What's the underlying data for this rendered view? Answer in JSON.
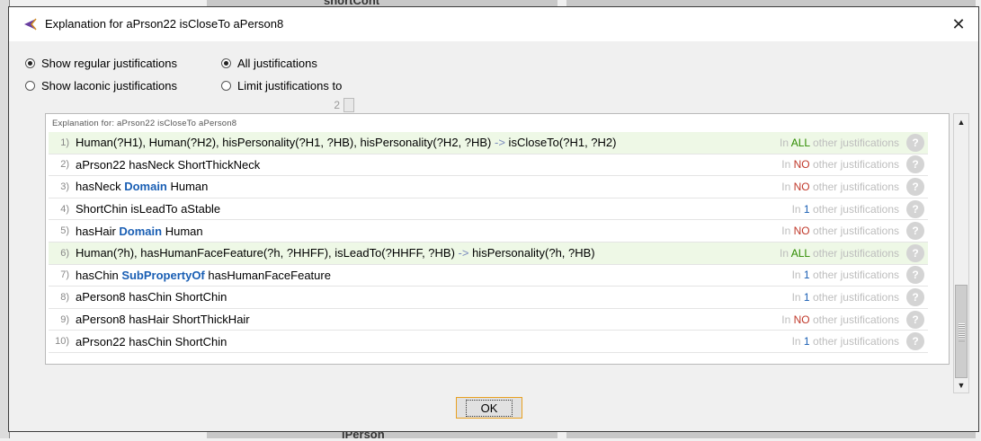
{
  "dialog": {
    "title": "Explanation for aPrson22 isCloseTo aPerson8",
    "close_label": "✕"
  },
  "options": {
    "show_regular": "Show regular justifications",
    "show_laconic": "Show laconic justifications",
    "all_justifications": "All justifications",
    "limit_justifications": "Limit justifications to",
    "limit_value": "2",
    "selected_mode": "regular",
    "selected_scope": "all"
  },
  "panel": {
    "header": "Explanation for: aPrson22 isCloseTo aPerson8",
    "rows": [
      {
        "num": "1)",
        "highlight": true,
        "parts": [
          {
            "t": "Human(?H1), Human(?H2), hisPersonality(?H1, ?HB), hisPersonality(?H2, ?HB) "
          },
          {
            "t": "->",
            "c": "arrow"
          },
          {
            "t": " isCloseTo(?H1, ?H2)"
          }
        ],
        "just_pre": "In ",
        "just_count": "ALL",
        "just_type": "all",
        "just_post": " other justifications"
      },
      {
        "num": "2)",
        "highlight": false,
        "parts": [
          {
            "t": "aPrson22 hasNeck ShortThickNeck"
          }
        ],
        "just_pre": "In ",
        "just_count": "NO",
        "just_type": "no",
        "just_post": " other justifications"
      },
      {
        "num": "3)",
        "highlight": false,
        "parts": [
          {
            "t": "hasNeck "
          },
          {
            "t": "Domain",
            "c": "kw"
          },
          {
            "t": " Human"
          }
        ],
        "just_pre": "In ",
        "just_count": "NO",
        "just_type": "no",
        "just_post": " other justifications"
      },
      {
        "num": "4)",
        "highlight": false,
        "parts": [
          {
            "t": "ShortChin isLeadTo aStable"
          }
        ],
        "just_pre": "In ",
        "just_count": "1",
        "just_type": "one",
        "just_post": " other justifications"
      },
      {
        "num": "5)",
        "highlight": false,
        "parts": [
          {
            "t": "hasHair "
          },
          {
            "t": "Domain",
            "c": "kw"
          },
          {
            "t": " Human"
          }
        ],
        "just_pre": "In ",
        "just_count": "NO",
        "just_type": "no",
        "just_post": " other justifications"
      },
      {
        "num": "6)",
        "highlight": true,
        "parts": [
          {
            "t": "Human(?h), hasHumanFaceFeature(?h, ?HHFF), isLeadTo(?HHFF, ?HB) "
          },
          {
            "t": "->",
            "c": "arrow"
          },
          {
            "t": " hisPersonality(?h, ?HB)"
          }
        ],
        "just_pre": "In ",
        "just_count": "ALL",
        "just_type": "all",
        "just_post": " other justifications"
      },
      {
        "num": "7)",
        "highlight": false,
        "parts": [
          {
            "t": "hasChin "
          },
          {
            "t": "SubPropertyOf",
            "c": "kw"
          },
          {
            "t": " hasHumanFaceFeature"
          }
        ],
        "just_pre": "In ",
        "just_count": "1",
        "just_type": "one",
        "just_post": " other justifications"
      },
      {
        "num": "8)",
        "highlight": false,
        "parts": [
          {
            "t": "aPerson8 hasChin ShortChin"
          }
        ],
        "just_pre": "In ",
        "just_count": "1",
        "just_type": "one",
        "just_post": " other justifications"
      },
      {
        "num": "9)",
        "highlight": false,
        "parts": [
          {
            "t": "aPerson8 hasHair ShortThickHair"
          }
        ],
        "just_pre": "In ",
        "just_count": "NO",
        "just_type": "no",
        "just_post": " other justifications"
      },
      {
        "num": "10)",
        "highlight": false,
        "parts": [
          {
            "t": "aPrson22 hasChin ShortChin"
          }
        ],
        "just_pre": "In ",
        "just_count": "1",
        "just_type": "one",
        "just_post": " other justifications"
      }
    ],
    "help_label": "?"
  },
  "buttons": {
    "ok": "OK"
  },
  "background": {
    "top_text": "shortCont",
    "bottom_text": "iPerson"
  },
  "colors": {
    "highlight_row": "#eef8e6",
    "keyword": "#1a5fb4",
    "all": "#2e8b00",
    "no": "#c0392b",
    "one": "#1a5fb4"
  }
}
